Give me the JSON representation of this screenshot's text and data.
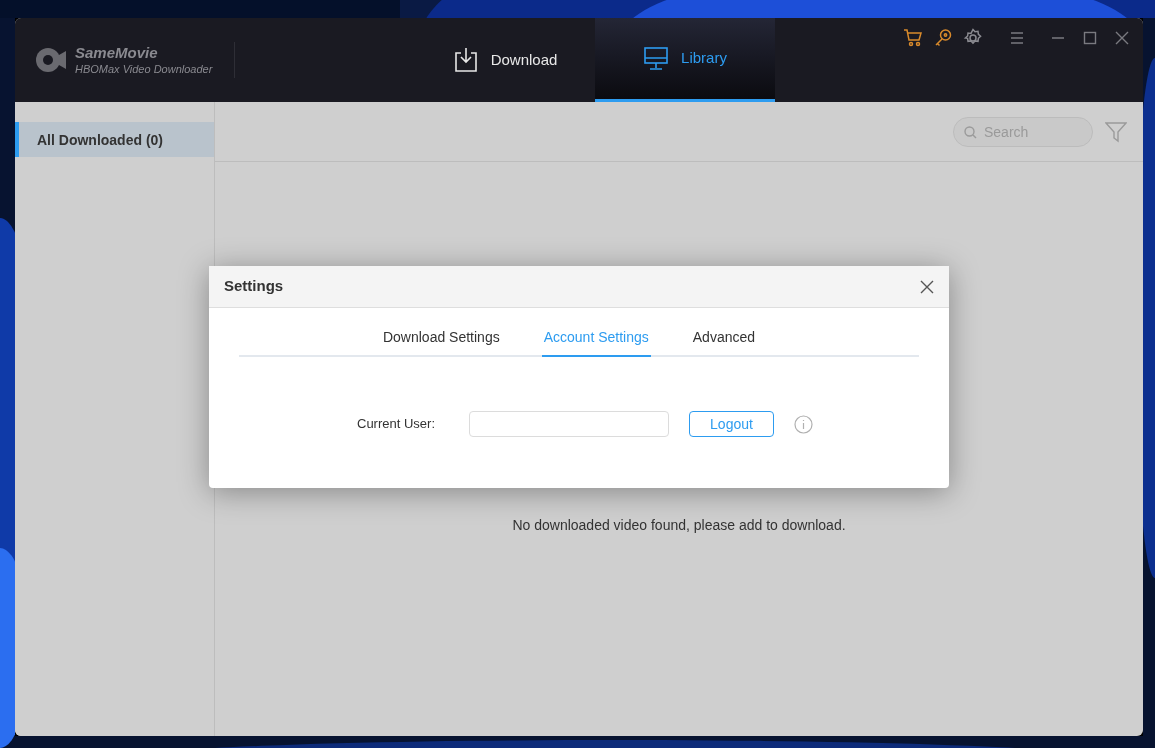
{
  "window": {
    "app_name": "SameMovie",
    "app_subtitle": "HBOMax Video Downloader"
  },
  "nav_tabs": [
    {
      "label": "Download",
      "selected": false
    },
    {
      "label": "Library",
      "selected": true
    }
  ],
  "sidebar": {
    "items": [
      {
        "label": "All Downloaded (0)",
        "selected": true
      }
    ]
  },
  "search": {
    "placeholder": "Search"
  },
  "empty_message": "No downloaded video found, please add to download.",
  "dialog": {
    "title": "Settings",
    "tabs": [
      {
        "label": "Download Settings",
        "selected": false
      },
      {
        "label": "Account Settings",
        "selected": true
      },
      {
        "label": "Advanced",
        "selected": false
      }
    ],
    "current_user": {
      "label": "Current User:"
    },
    "button": "Logout"
  }
}
